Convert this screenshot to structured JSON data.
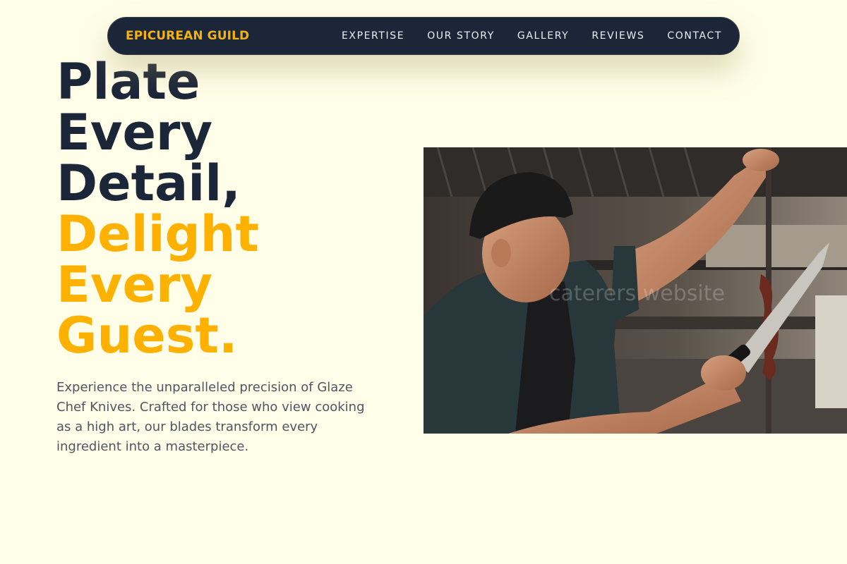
{
  "nav": {
    "brand": "EPICUREAN GUILD",
    "items": [
      {
        "label": "EXPERTISE"
      },
      {
        "label": "OUR STORY"
      },
      {
        "label": "GALLERY"
      },
      {
        "label": "REVIEWS"
      },
      {
        "label": "CONTACT"
      }
    ]
  },
  "hero": {
    "title_lines": [
      "Plate",
      "Every",
      "Detail,"
    ],
    "accent_lines": [
      "Delight",
      "Every",
      "Guest."
    ],
    "description": "Experience the unparalleled precision of Glaze Chef Knives. Crafted for those who view cooking as a high art, our blades transform every ingredient into a masterpiece."
  },
  "photo": {
    "watermark": "caterers website"
  },
  "colors": {
    "background": "#FFFEE8",
    "navy": "#1C2639",
    "accent": "#FFB100",
    "body_text": "#4f5563"
  }
}
